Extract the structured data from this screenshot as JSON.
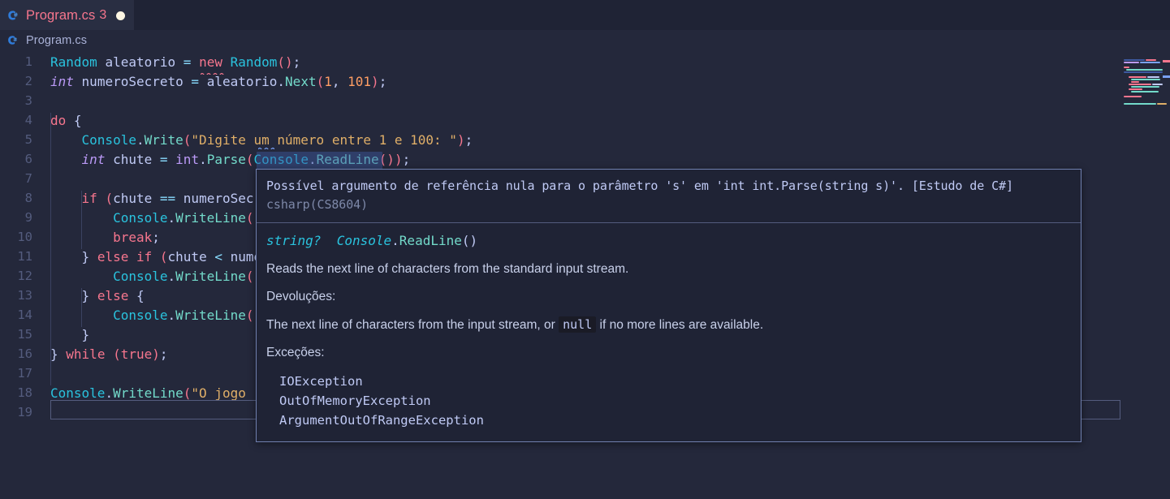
{
  "tab": {
    "icon": "csharp-file-icon",
    "label": "Program.cs",
    "error_count": "3",
    "dirty_indicator": "unsaved-dot",
    "label_color": "#f7768e"
  },
  "breadcrumb": {
    "icon": "csharp-file-icon",
    "text": "Program.cs"
  },
  "editor": {
    "language": "csharp",
    "active_line": "19",
    "lines": [
      {
        "no": "1",
        "text": "Random aleatorio = new Random();"
      },
      {
        "no": "2",
        "text": "int numeroSecreto = aleatorio.Next(1, 101);"
      },
      {
        "no": "3",
        "text": ""
      },
      {
        "no": "4",
        "text": "do {"
      },
      {
        "no": "5",
        "text": "    Console.Write(\"Digite um número entre 1 e 100: \");"
      },
      {
        "no": "6",
        "text": "    int chute = int.Parse(Console.ReadLine());"
      },
      {
        "no": "7",
        "text": ""
      },
      {
        "no": "8",
        "text": "    if (chute == numeroSecreto) {"
      },
      {
        "no": "9",
        "text": "        Console.WriteLine("
      },
      {
        "no": "10",
        "text": "        break;"
      },
      {
        "no": "11",
        "text": "    } else if (chute < numeroSecreto) {"
      },
      {
        "no": "12",
        "text": "        Console.WriteLine("
      },
      {
        "no": "13",
        "text": "    } else {"
      },
      {
        "no": "14",
        "text": "        Console.WriteLine("
      },
      {
        "no": "15",
        "text": "    }"
      },
      {
        "no": "16",
        "text": "} while (true);"
      },
      {
        "no": "17",
        "text": ""
      },
      {
        "no": "18",
        "text": "Console.WriteLine(\"O jogo"
      },
      {
        "no": "19",
        "text": ""
      }
    ],
    "hovered_symbol": "Console.ReadLine()"
  },
  "hover": {
    "diagnostic": {
      "message": "Possível argumento de referência nula para o parâmetro 's' em 'int int.Parse(string s)'. [Estudo de C#]",
      "code": "csharp(CS8604)"
    },
    "signature": {
      "return_type": "string?",
      "owner": "Console",
      "separator": ".",
      "member": "ReadLine",
      "params": "()"
    },
    "summary": "Reads the next line of characters from the standard input stream.",
    "returns_label": "Devoluções:",
    "returns_text_before": "The next line of characters from the input stream, or",
    "returns_inline_code": "null",
    "returns_text_after": "if no more lines are available.",
    "exceptions_label": "Exceções:",
    "exceptions": [
      "IOException",
      "OutOfMemoryException",
      "ArgumentOutOfRangeException"
    ]
  },
  "colors": {
    "editor_background": "#24283b",
    "tabbar_background": "#1f2335",
    "hover_background": "#1f2335",
    "hover_border": "#7080b0",
    "error_foreground": "#f7768e",
    "line_number": "#545c7e"
  }
}
